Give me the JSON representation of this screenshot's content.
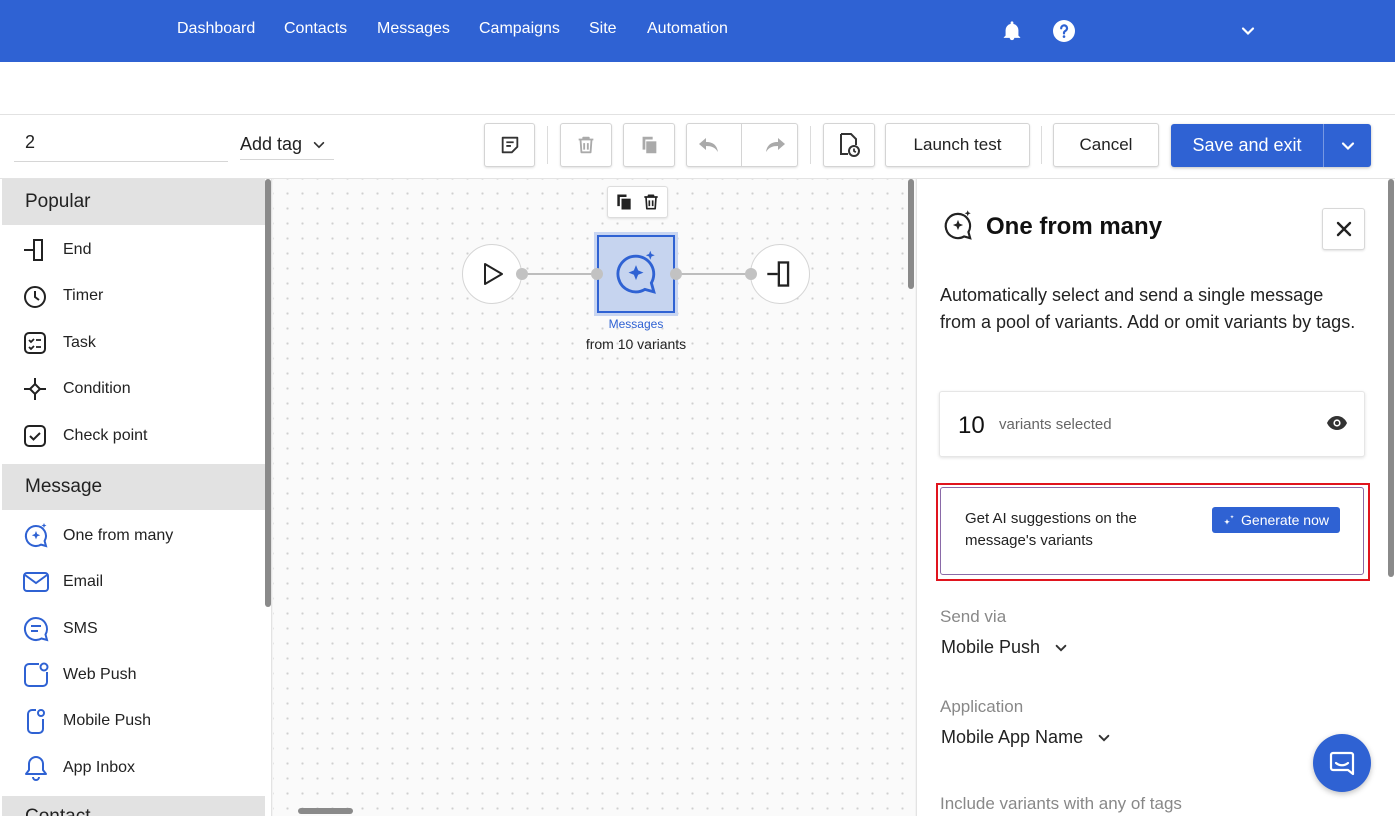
{
  "nav": {
    "items": [
      "Dashboard",
      "Contacts",
      "Messages",
      "Campaigns",
      "Site",
      "Automation"
    ]
  },
  "toolbar": {
    "name_value": "2",
    "add_tag_label": "Add tag",
    "launch_test_label": "Launch test",
    "cancel_label": "Cancel",
    "save_label": "Save and exit"
  },
  "sidebar": {
    "sections": [
      {
        "title": "Popular",
        "items": [
          "End",
          "Timer",
          "Task",
          "Condition",
          "Check point"
        ]
      },
      {
        "title": "Message",
        "items": [
          "One from many",
          "Email",
          "SMS",
          "Web Push",
          "Mobile Push",
          "App Inbox"
        ]
      },
      {
        "title": "Contact"
      }
    ]
  },
  "canvas": {
    "node_label": "Messages",
    "node_sub": "from 10 variants"
  },
  "panel": {
    "title": "One from many",
    "description": "Automatically select and send a single message from a pool of variants. Add or omit variants by tags.",
    "variants_count": "10",
    "variants_text": "variants selected",
    "ai_text": "Get AI suggestions on the message's variants",
    "generate_label": "Generate now",
    "send_via_label": "Send via",
    "send_via_value": "Mobile Push",
    "application_label": "Application",
    "application_value": "Mobile App Name",
    "include_label": "Include variants with any of tags"
  },
  "colors": {
    "brand": "#2f62d3",
    "highlight": "#e0141e"
  }
}
